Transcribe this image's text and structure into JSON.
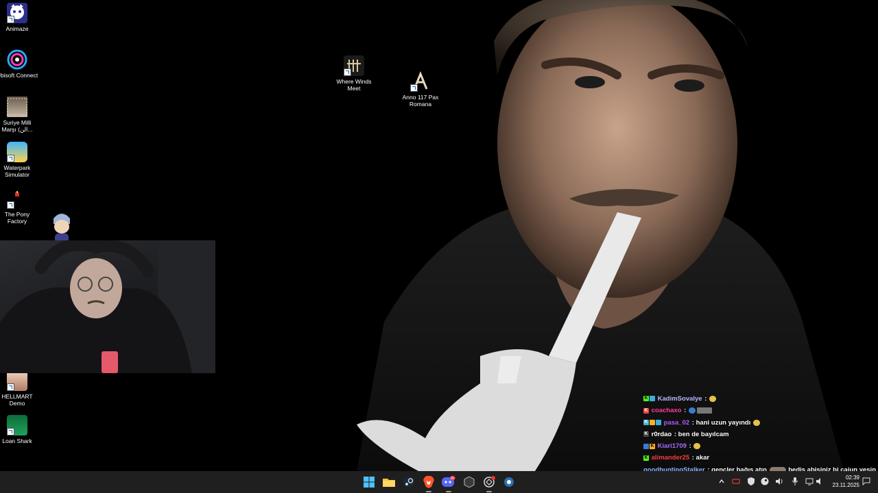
{
  "desktop": {
    "icons": [
      {
        "label": "Animaze",
        "icon": "animaze-icon"
      },
      {
        "label": "Ubisoft Connect",
        "icon": "ubisoft-icon"
      },
      {
        "label": "Suriye Milli Marşı (الن...",
        "icon": "video-file-icon"
      },
      {
        "label": "Waterpark Simulator",
        "icon": "waterpark-icon"
      },
      {
        "label": "The Pony Factory",
        "icon": "pony-factory-icon"
      },
      {
        "label": "HELLMART Demo",
        "icon": "hellmart-icon"
      },
      {
        "label": "Loan Shark",
        "icon": "loan-shark-icon"
      },
      {
        "label": "Where Winds Meet",
        "icon": "where-winds-meet-icon"
      },
      {
        "label": "Anno 117 Pax Romana",
        "icon": "anno-icon"
      }
    ]
  },
  "chat": {
    "messages": [
      {
        "user": "KadimSovalye",
        "color": "#b6b6ff",
        "text": "",
        "emote": "emote-icon"
      },
      {
        "user": "coachaxo",
        "color": "#ff3d9a",
        "text": "",
        "emote": "emote-icon"
      },
      {
        "user": "pasa_02",
        "color": "#b05bff",
        "text": "hani uzun yayındı",
        "emote": "emote-icon"
      },
      {
        "user": "r0rdao",
        "color": "#ffffff",
        "text": "ben de bayılcam",
        "emote": ""
      },
      {
        "user": "Kiari1709",
        "color": "#a66bff",
        "text": "",
        "emote": "emote-icon"
      },
      {
        "user": "alimander25",
        "color": "#ff3b3b",
        "text": "akar",
        "emote": ""
      },
      {
        "user": "goodhuntingStalker",
        "color": "#8ab4ff",
        "text": "gençler bağış atın",
        "emote": "emote-icon",
        "text2": "bediş abişiniz bi cajun yesin"
      }
    ]
  },
  "taskbar": {
    "apps": [
      "windows-start-icon",
      "file-explorer-icon",
      "steam-icon",
      "brave-browser-icon",
      "discord-icon",
      "obs-icon",
      "app-icon",
      "steam-settings-icon"
    ],
    "discord_badge": "9+",
    "clock": {
      "time": "02:39",
      "date": "23.11.2025"
    }
  }
}
